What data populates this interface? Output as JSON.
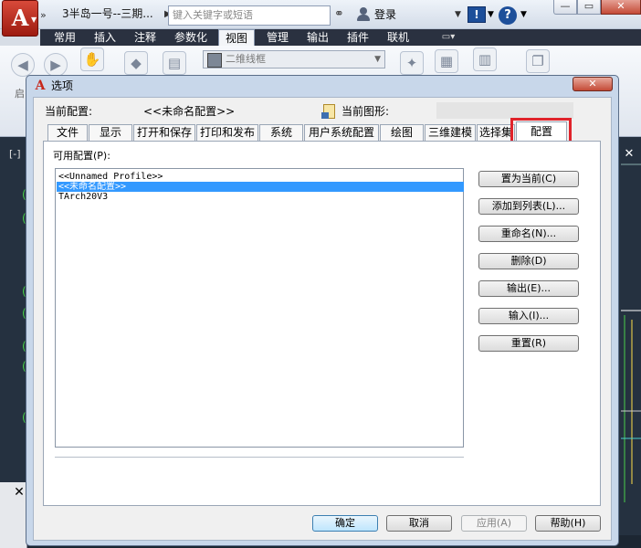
{
  "app": {
    "logo": "A",
    "title": "3半岛一号--三期...",
    "search_placeholder": "键入关键字或短语",
    "login_label": "登录",
    "exchange_label": "!",
    "help_label": "?",
    "window_controls": {
      "minimize": "—",
      "restore": "▭",
      "close": "✕"
    }
  },
  "ribbon": {
    "tabs": [
      "常用",
      "插入",
      "注释",
      "参数化",
      "视图",
      "管理",
      "输出",
      "插件",
      "联机"
    ],
    "active_tab": "视图",
    "visual_style": "二维线框",
    "partial_label": "启"
  },
  "drawing": {
    "viewport_label": "[-]",
    "close_glyph": "✕",
    "marker_glyph": "(",
    "command_close": "✕"
  },
  "dialog": {
    "title": "选项",
    "close_label": "✕",
    "current_profile_label": "当前配置:",
    "current_profile_value": "<<未命名配置>>",
    "current_drawing_label": "当前图形:",
    "tabs": [
      "文件",
      "显示",
      "打开和保存",
      "打印和发布",
      "系统",
      "用户系统配置",
      "绘图",
      "三维建模",
      "选择集",
      "配置"
    ],
    "active_tab": "配置",
    "available_profiles_label": "可用配置(P):",
    "profiles": [
      "<<Unnamed Profile>>",
      "<<未命名配置>>",
      "TArch20V3"
    ],
    "selected_profile_index": 1,
    "side_buttons": [
      "置为当前(C)",
      "添加到列表(L)...",
      "重命名(N)...",
      "删除(D)",
      "输出(E)...",
      "输入(I)...",
      "重置(R)"
    ],
    "footer_buttons": {
      "ok": "确定",
      "cancel": "取消",
      "apply": "应用(A)",
      "help": "帮助(H)"
    }
  }
}
